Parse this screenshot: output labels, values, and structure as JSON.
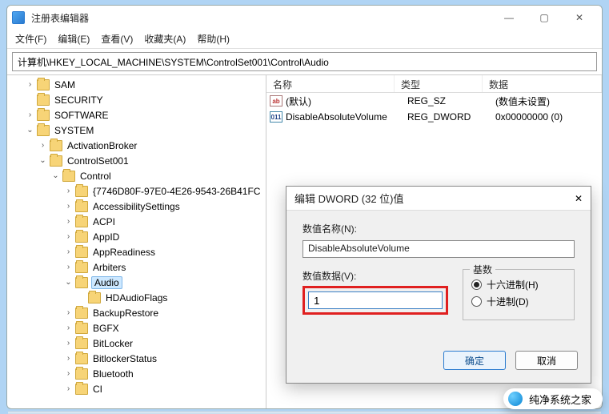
{
  "window": {
    "title": "注册表编辑器",
    "controls": {
      "min": "—",
      "max": "▢",
      "close": "✕"
    }
  },
  "menu": {
    "file": "文件(F)",
    "edit": "编辑(E)",
    "view": "查看(V)",
    "favorites": "收藏夹(A)",
    "help": "帮助(H)"
  },
  "addressbar": "计算机\\HKEY_LOCAL_MACHINE\\SYSTEM\\ControlSet001\\Control\\Audio",
  "tree": [
    {
      "depth": 1,
      "tw": ">",
      "open": false,
      "label": "SAM"
    },
    {
      "depth": 1,
      "tw": "",
      "open": false,
      "label": "SECURITY"
    },
    {
      "depth": 1,
      "tw": ">",
      "open": false,
      "label": "SOFTWARE"
    },
    {
      "depth": 1,
      "tw": "v",
      "open": true,
      "label": "SYSTEM"
    },
    {
      "depth": 2,
      "tw": ">",
      "open": false,
      "label": "ActivationBroker"
    },
    {
      "depth": 2,
      "tw": "v",
      "open": true,
      "label": "ControlSet001"
    },
    {
      "depth": 3,
      "tw": "v",
      "open": true,
      "label": "Control"
    },
    {
      "depth": 4,
      "tw": ">",
      "open": false,
      "label": "{7746D80F-97E0-4E26-9543-26B41FC"
    },
    {
      "depth": 4,
      "tw": ">",
      "open": false,
      "label": "AccessibilitySettings"
    },
    {
      "depth": 4,
      "tw": ">",
      "open": false,
      "label": "ACPI"
    },
    {
      "depth": 4,
      "tw": ">",
      "open": false,
      "label": "AppID"
    },
    {
      "depth": 4,
      "tw": ">",
      "open": false,
      "label": "AppReadiness"
    },
    {
      "depth": 4,
      "tw": ">",
      "open": false,
      "label": "Arbiters"
    },
    {
      "depth": 4,
      "tw": "v",
      "open": true,
      "label": "Audio",
      "selected": true
    },
    {
      "depth": 5,
      "tw": "",
      "open": false,
      "label": "HDAudioFlags"
    },
    {
      "depth": 4,
      "tw": ">",
      "open": false,
      "label": "BackupRestore"
    },
    {
      "depth": 4,
      "tw": ">",
      "open": false,
      "label": "BGFX"
    },
    {
      "depth": 4,
      "tw": ">",
      "open": false,
      "label": "BitLocker"
    },
    {
      "depth": 4,
      "tw": ">",
      "open": false,
      "label": "BitlockerStatus"
    },
    {
      "depth": 4,
      "tw": ">",
      "open": false,
      "label": "Bluetooth"
    },
    {
      "depth": 4,
      "tw": ">",
      "open": false,
      "label": "CI"
    }
  ],
  "list": {
    "headers": {
      "name": "名称",
      "type": "类型",
      "data": "数据"
    },
    "rows": [
      {
        "icon": "ab",
        "name": "(默认)",
        "type": "REG_SZ",
        "data": "(数值未设置)"
      },
      {
        "icon": "dw",
        "name": "DisableAbsoluteVolume",
        "type": "REG_DWORD",
        "data": "0x00000000 (0)"
      }
    ]
  },
  "dialog": {
    "title": "编辑 DWORD (32 位)值",
    "close": "✕",
    "name_label": "数值名称(N):",
    "name_value": "DisableAbsoluteVolume",
    "data_label": "数值数据(V):",
    "data_value": "1",
    "base_label": "基数",
    "radio_hex": "十六进制(H)",
    "radio_dec": "十进制(D)",
    "ok": "确定",
    "cancel": "取消"
  },
  "watermark": "纯净系统之家"
}
